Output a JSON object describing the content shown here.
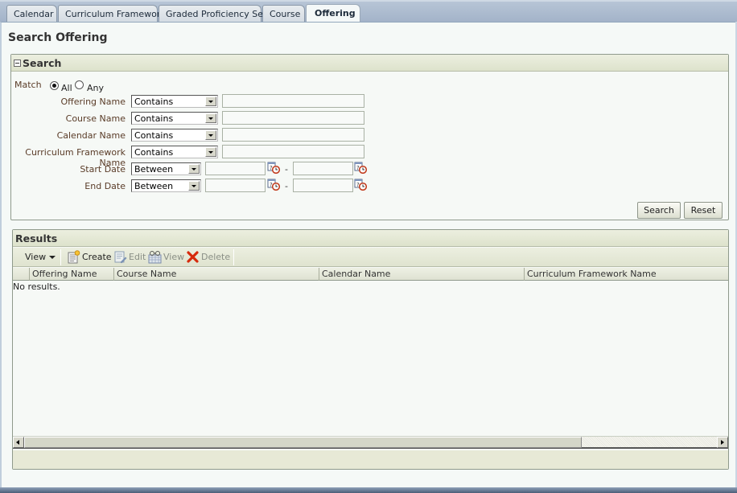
{
  "tabs": [
    {
      "label": "Calendar",
      "active": false
    },
    {
      "label": "Curriculum Framework",
      "active": false
    },
    {
      "label": "Graded Proficiency Set",
      "active": false
    },
    {
      "label": "Course",
      "active": false
    },
    {
      "label": "Offering",
      "active": true
    }
  ],
  "page_title": "Search Offering",
  "search": {
    "title": "Search",
    "match": {
      "label": "Match",
      "options": [
        "All",
        "Any"
      ],
      "selected": "All"
    },
    "fields": [
      {
        "label": "Offering Name",
        "operator": "Contains",
        "value": ""
      },
      {
        "label": "Course Name",
        "operator": "Contains",
        "value": ""
      },
      {
        "label": "Calendar Name",
        "operator": "Contains",
        "value": ""
      },
      {
        "label": "Curriculum Framework Name",
        "operator": "Contains",
        "value": ""
      }
    ],
    "date_fields": [
      {
        "label": "Start Date",
        "operator": "Between",
        "from": "",
        "to": "",
        "separator": "-"
      },
      {
        "label": "End Date",
        "operator": "Between",
        "from": "",
        "to": "",
        "separator": "-"
      }
    ],
    "buttons": {
      "search": "Search",
      "reset": "Reset"
    }
  },
  "results": {
    "title": "Results",
    "toolbar": {
      "view_menu": "View",
      "create": "Create",
      "edit": "Edit",
      "view": "View",
      "delete": "Delete"
    },
    "columns": [
      "Offering Name",
      "Course Name",
      "Calendar Name",
      "Curriculum Framework Name"
    ],
    "rows": [],
    "empty_text": "No results."
  },
  "colors": {
    "label_text": "#5a3c28",
    "panel_header": "#dde2cc",
    "tab_bar": "#a3b3c9",
    "delete_icon": "#d62a0c"
  }
}
